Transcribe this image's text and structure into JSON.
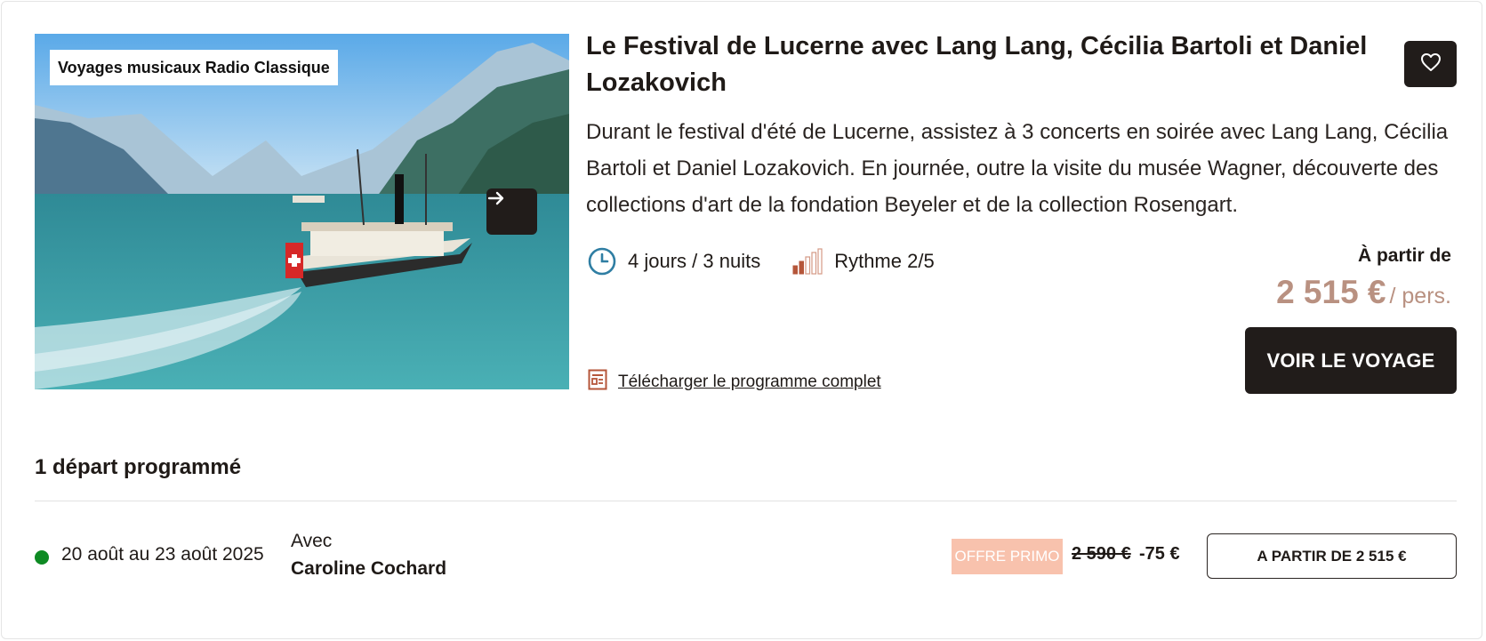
{
  "card": {
    "image_tag": "Voyages musicaux Radio Classique",
    "image_alt": "Bateau à vapeur sur le lac des Quatre-Cantons",
    "title": "Le Festival de Lucerne avec Lang Lang, Cécilia Bartoli et Daniel Lozakovich",
    "description": "Durant le festival d'été de Lucerne, assistez à 3 concerts en soirée avec Lang Lang, Cécilia Bartoli et Daniel Lozakovich. En journée, outre la visite du musée Wagner, découverte des collections d'art de la fondation Beyeler et de la collection Rosengart.",
    "duration": "4 jours / 3 nuits",
    "rhythm": "Rythme 2/5",
    "rhythm_level": 2,
    "rhythm_max": 5,
    "from_label": "À partir de",
    "price": "2 515 €",
    "per_person": "/ pers.",
    "cta_label": "VOIR LE VOYAGE",
    "download_label": "Télécharger le programme complet"
  },
  "departures": {
    "heading": "1 départ programmé",
    "items": [
      {
        "dates": "20 août au 23 août 2025",
        "with_label": "Avec",
        "guide": "Caroline Cochard",
        "badge": "OFFRE PRIMO",
        "old_price": "2 590 €",
        "discount": "-75 €",
        "button_label": "A PARTIR DE 2 515 €",
        "status_color": "#0e8a23"
      }
    ]
  },
  "colors": {
    "dark": "#211c1a",
    "price": "#b99181",
    "badge_bg": "#f8c2ad",
    "accent_icon": "#b5563a",
    "clock_icon": "#2f7ea3"
  },
  "icons": {
    "next": "arrow-right-icon",
    "favorite": "heart-icon",
    "duration": "clock-icon",
    "rhythm": "rhythm-bars-icon",
    "download": "document-icon"
  }
}
